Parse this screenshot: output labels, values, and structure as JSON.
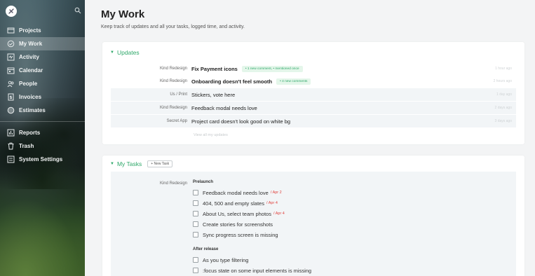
{
  "sidebar": {
    "nav_primary": [
      {
        "label": "Projects",
        "icon": "folder-icon"
      },
      {
        "label": "My Work",
        "icon": "check-circle-icon",
        "active": true
      },
      {
        "label": "Activity",
        "icon": "activity-icon"
      },
      {
        "label": "Calendar",
        "icon": "calendar-icon"
      },
      {
        "label": "People",
        "icon": "people-icon"
      },
      {
        "label": "Invoices",
        "icon": "invoice-icon"
      },
      {
        "label": "Estimates",
        "icon": "estimate-icon"
      }
    ],
    "nav_secondary": [
      {
        "label": "Reports",
        "icon": "reports-icon"
      },
      {
        "label": "Trash",
        "icon": "trash-icon"
      },
      {
        "label": "System Settings",
        "icon": "settings-icon"
      }
    ]
  },
  "page": {
    "title": "My Work",
    "subtitle": "Keep track of updates and all your tasks, logged time, and activity."
  },
  "updates": {
    "heading": "Updates",
    "rows": [
      {
        "project": "Kind Redesign",
        "title": "Fix Payment icons",
        "bold": true,
        "badge": "• 1 new comment, • mentioned once",
        "time": "1 hour ago"
      },
      {
        "project": "Kind Redesign",
        "title": "Onboarding doesn't feel smooth",
        "bold": true,
        "badge": "• 4 new comments",
        "time": "2 hours ago"
      },
      {
        "project": "Us / Print",
        "title": "Stickers, vote here",
        "bold": false,
        "badge": "",
        "time": "1 day ago"
      },
      {
        "project": "Kind Redesign",
        "title": "Feedback modal needs love",
        "bold": false,
        "badge": "",
        "time": "2 days ago"
      },
      {
        "project": "Secret App",
        "title": "Project card doesn't look good on white bg",
        "bold": false,
        "badge": "",
        "time": "3 days ago"
      }
    ],
    "view_all": "View all my updates"
  },
  "tasks": {
    "heading": "My Tasks",
    "new_task_label": "+ New Task",
    "project": "Kind Redesign",
    "groups": [
      {
        "label": "Prelaunch",
        "items": [
          {
            "title": "Feedback modal needs love",
            "due": "/ Apr 2"
          },
          {
            "title": "404, 500 and empty slates",
            "due": "/ Apr 4"
          },
          {
            "title": "About Us, select team photos",
            "due": "/ Apr 4"
          },
          {
            "title": "Create stories for screenshots",
            "due": ""
          },
          {
            "title": "Sync progress screen is missing",
            "due": ""
          }
        ]
      },
      {
        "label": "After release",
        "items": [
          {
            "title": "As you type filtering",
            "due": ""
          },
          {
            "title": ":focus state on some input elements is missing",
            "due": ""
          }
        ]
      }
    ]
  },
  "colors": {
    "accent_green": "#2fa86a",
    "due_red": "#e0433f",
    "badge_bg": "#e4f6ea"
  }
}
